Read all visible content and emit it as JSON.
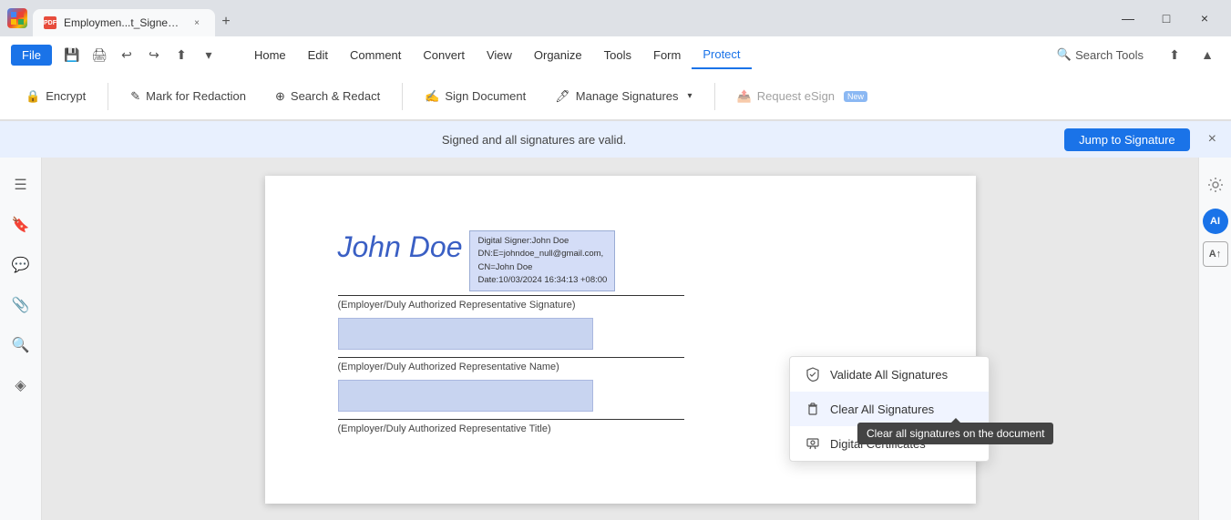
{
  "browser": {
    "logo": "F",
    "tab": {
      "icon": "PDF",
      "title": "Employmen...t_Signed.pdf",
      "close": "×"
    },
    "new_tab": "+",
    "window_controls": [
      "—",
      "□",
      "×"
    ]
  },
  "app": {
    "file_label": "File",
    "toolbar_menus": [
      "Home",
      "Edit",
      "Comment",
      "Convert",
      "View",
      "Organize",
      "Tools",
      "Form",
      "Protect"
    ],
    "search_tools_label": "Search Tools",
    "toolbar2": {
      "encrypt_label": "Encrypt",
      "mark_redaction_label": "Mark for Redaction",
      "search_redact_label": "Search & Redact",
      "sign_document_label": "Sign Document",
      "manage_signatures_label": "Manage Signatures",
      "request_esign_label": "Request eSign",
      "new_badge": "New"
    },
    "notification": {
      "text": "Signed and all signatures are valid.",
      "jump_label": "Jump to Signature",
      "close": "×"
    },
    "dropdown": {
      "items": [
        {
          "icon": "shield",
          "label": "Validate All Signatures"
        },
        {
          "icon": "trash",
          "label": "Clear All Signatures"
        },
        {
          "icon": "cert",
          "label": "Digital Certificates"
        }
      ]
    },
    "tooltip": "Clear all signatures on the document",
    "doc": {
      "sig_name": "John Doe",
      "sig_info": "Digital Signer:John Doe\nDN:E=johndoe_null@gmail.com,\nCN=John Doe\nDate:10/03/2024 16:34:13 +08:00",
      "sig_line1": "(Employer/Duly Authorized Representative Signature)",
      "sig_line2": "(Employer/Duly Authorized Representative Name)",
      "sig_line3": "(Employer/Duly Authorized Representative Title)"
    }
  },
  "sidebar_left": {
    "icons": [
      "☰",
      "🔖",
      "💬",
      "📎",
      "🔍",
      "⬡"
    ]
  },
  "sidebar_right": {
    "icons": [
      "⚙",
      "A",
      "A"
    ]
  }
}
